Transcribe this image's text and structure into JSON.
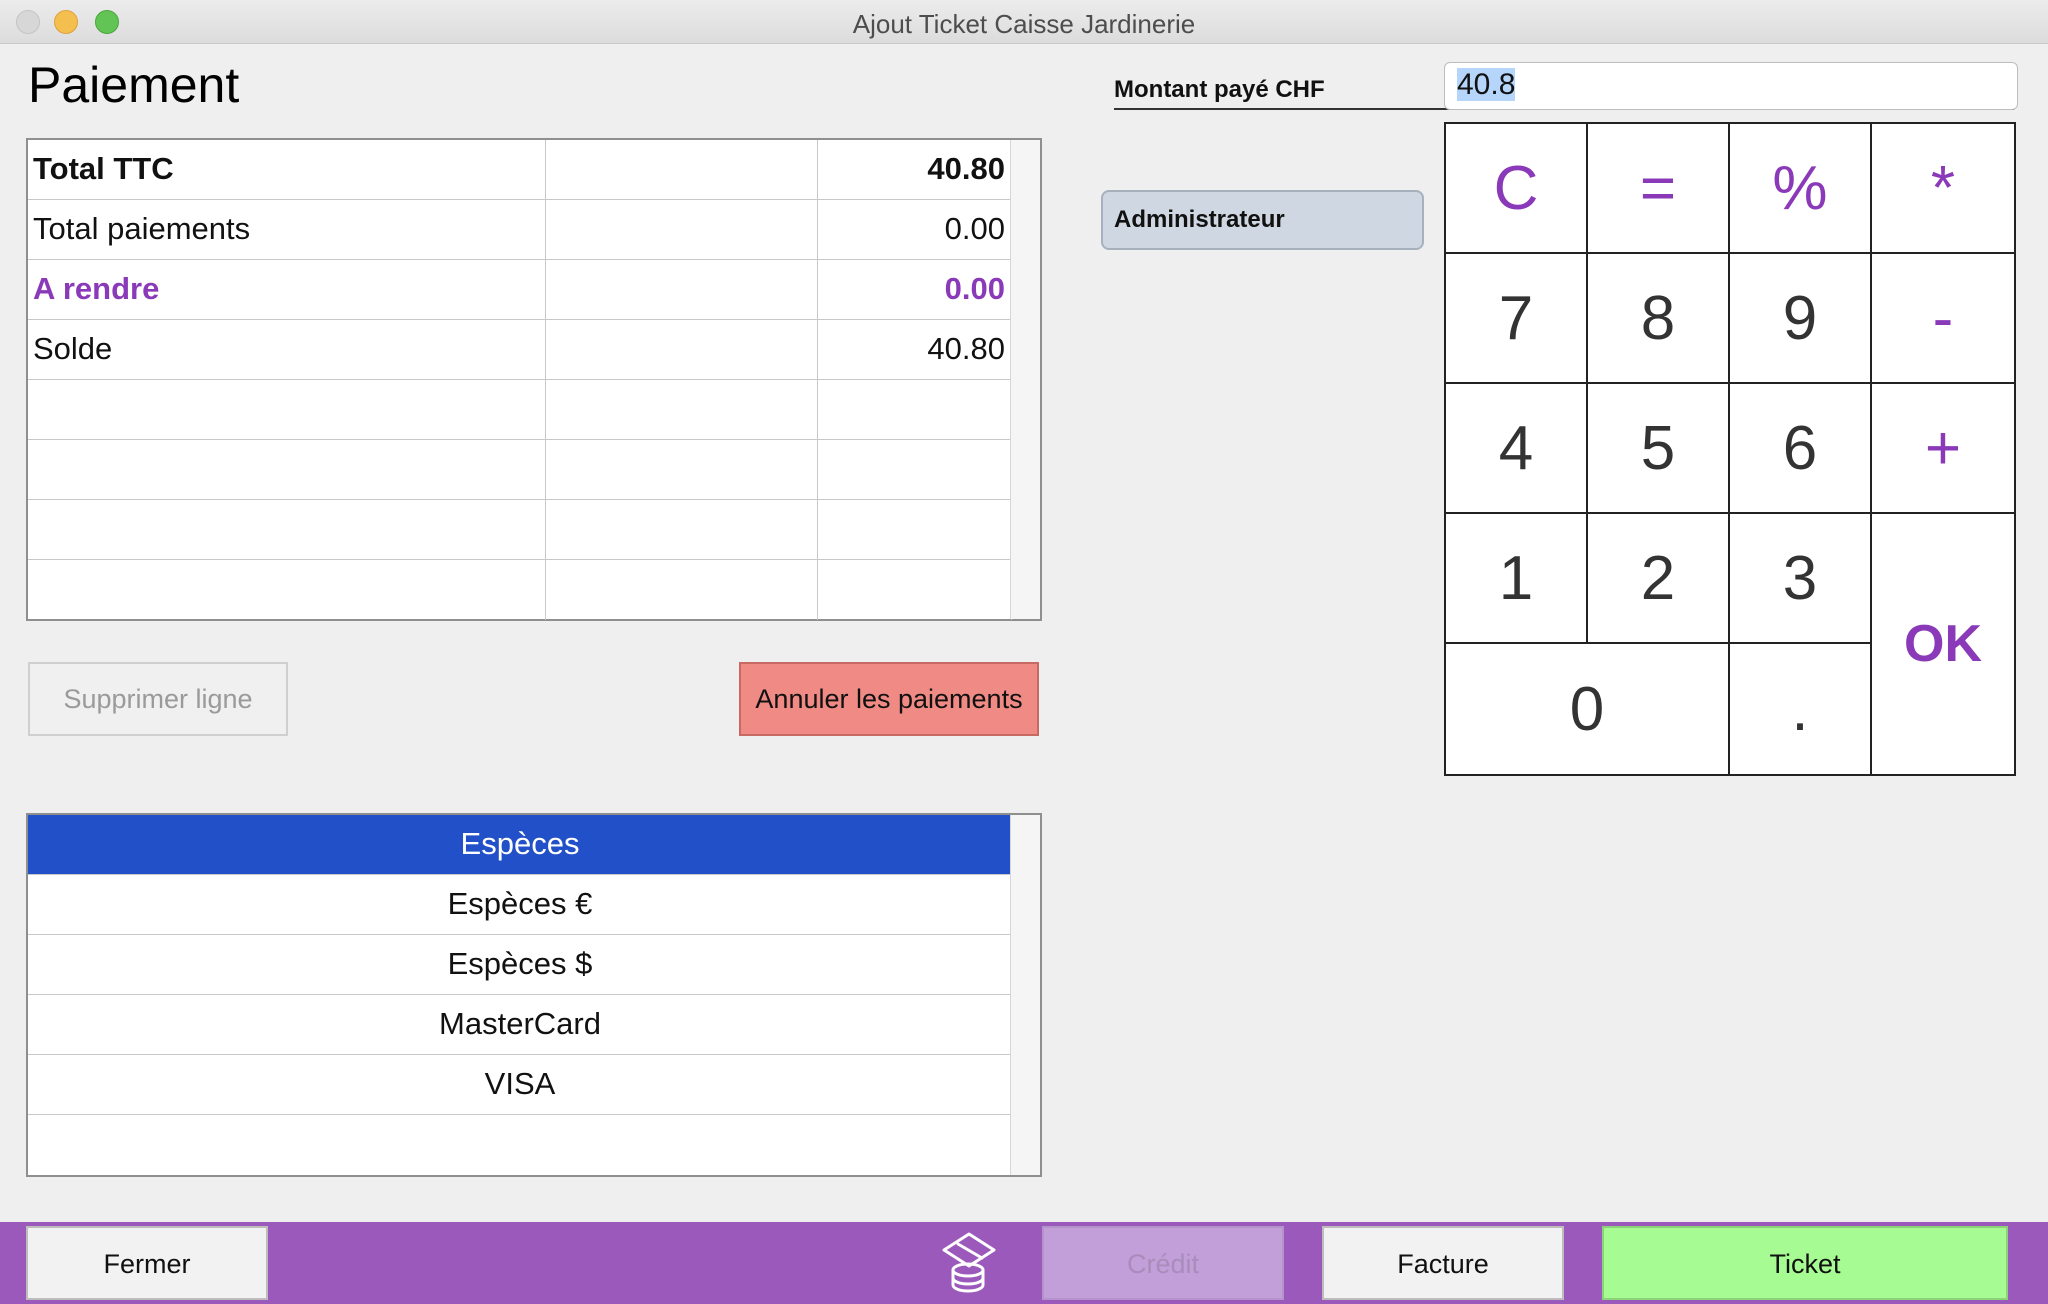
{
  "window": {
    "title": "Ajout Ticket Caisse Jardinerie"
  },
  "page": {
    "title": "Paiement"
  },
  "totals": {
    "rows": [
      {
        "label": "Total TTC",
        "middle": "",
        "value": "40.80"
      },
      {
        "label": "Total paiements",
        "middle": "",
        "value": "0.00"
      },
      {
        "label": "A rendre",
        "middle": "",
        "value": "0.00"
      },
      {
        "label": "Solde",
        "middle": "",
        "value": "40.80"
      }
    ]
  },
  "actions": {
    "delete_line": "Supprimer ligne",
    "cancel_payments": "Annuler les paiements"
  },
  "payment_methods": {
    "selected": "Espèces",
    "items": [
      "Espèces",
      "Espèces €",
      "Espèces $",
      "MasterCard",
      "VISA"
    ]
  },
  "amount": {
    "label": "Montant payé CHF",
    "value": "40.8"
  },
  "user": {
    "label": "Administrateur"
  },
  "keypad": {
    "clear": "C",
    "equals": "=",
    "percent": "%",
    "multiply": "*",
    "k7": "7",
    "k8": "8",
    "k9": "9",
    "minus": "-",
    "k4": "4",
    "k5": "5",
    "k6": "6",
    "plus": "+",
    "k1": "1",
    "k2": "2",
    "k3": "3",
    "ok": "OK",
    "k0": "0",
    "dot": "."
  },
  "footer": {
    "close": "Fermer",
    "credit": "Crédit",
    "invoice": "Facture",
    "ticket": "Ticket",
    "drawer_icon": "cash-drawer-icon"
  },
  "colors": {
    "accent_purple": "#8a3ab9",
    "footer_bar": "#9b59bb",
    "selection_blue": "#2250c8",
    "cancel_red": "#f08a84",
    "ticket_green": "#a6fb93"
  }
}
